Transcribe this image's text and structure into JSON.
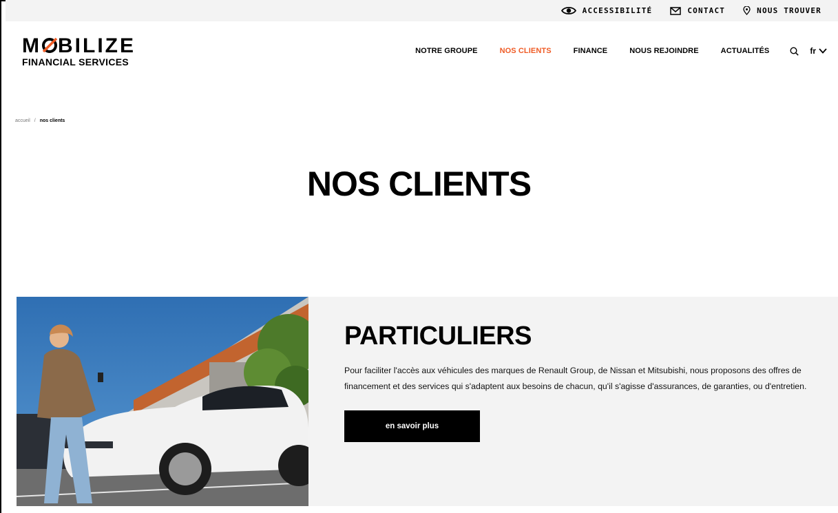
{
  "utility": {
    "accessibility": "ACCESSIBILITÉ",
    "contact": "CONTACT",
    "find_us": "NOUS TROUVER"
  },
  "logo": {
    "main_left": "M",
    "main_right": "BILIZE",
    "sub": "FINANCIAL SERVICES"
  },
  "nav": {
    "items": [
      {
        "label": "NOTRE GROUPE"
      },
      {
        "label": "NOS CLIENTS"
      },
      {
        "label": "FINANCE"
      },
      {
        "label": "NOUS REJOINDRE"
      },
      {
        "label": "ACTUALITÉS"
      }
    ],
    "lang": "fr"
  },
  "breadcrumb": {
    "home": "accueil",
    "separator": "/",
    "current": "nos clients"
  },
  "page": {
    "title": "NOS CLIENTS"
  },
  "card": {
    "title": "PARTICULIERS",
    "text": "Pour faciliter l'accès aux véhicules des marques de Renault Group, de Nissan et Mitsubishi, nous proposons des offres de financement et des services qui s'adaptent aux besoins de chacun, qu'il s'agisse d'assurances, de garanties, ou d'entretien.",
    "button": "en savoir plus"
  },
  "colors": {
    "accent": "#ef5b25",
    "utility_bg": "#f3f3f3",
    "card_bg": "#f3f3f3",
    "button_bg": "#000000"
  },
  "icons": [
    "eye-icon",
    "mail-icon",
    "location-pin-icon",
    "search-icon",
    "chevron-down-icon"
  ]
}
